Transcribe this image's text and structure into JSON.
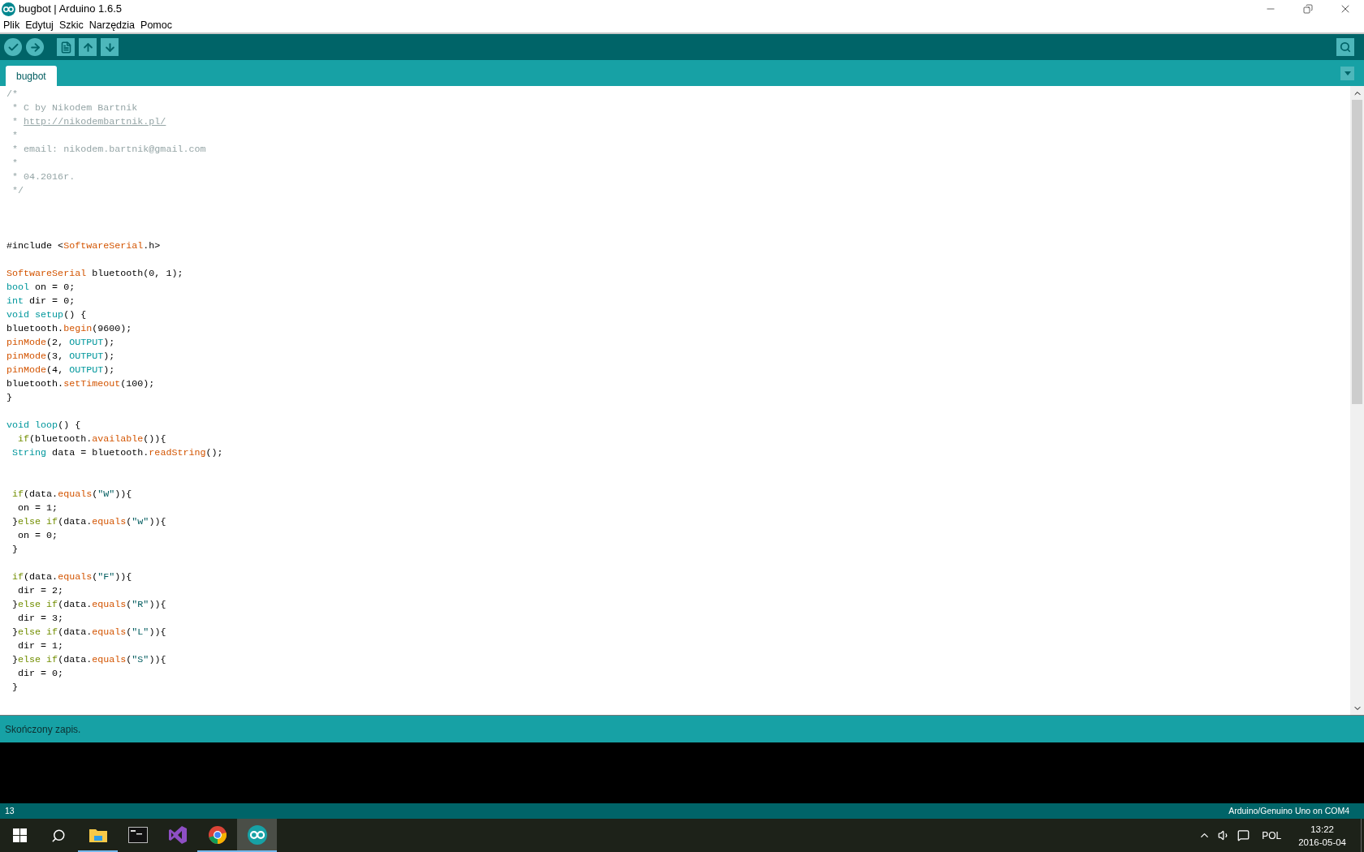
{
  "window": {
    "title": "bugbot | Arduino 1.6.5"
  },
  "menu": [
    {
      "label": "Plik"
    },
    {
      "label": "Edytuj"
    },
    {
      "label": "Szkic"
    },
    {
      "label": "Narzędzia"
    },
    {
      "label": "Pomoc"
    }
  ],
  "tabs": [
    {
      "label": "bugbot",
      "selected": true
    }
  ],
  "editor": {
    "lines": [
      {
        "tokens": [
          {
            "text": "/*",
            "kind": "comment"
          }
        ]
      },
      {
        "tokens": [
          {
            "text": " * C by Nikodem Bartnik",
            "kind": "comment"
          }
        ]
      },
      {
        "tokens": [
          {
            "text": " * ",
            "kind": "comment"
          },
          {
            "text": "http://nikodembartnik.pl/",
            "kind": "link"
          }
        ]
      },
      {
        "tokens": [
          {
            "text": " *",
            "kind": "comment"
          }
        ]
      },
      {
        "tokens": [
          {
            "text": " * email: nikodem.bartnik@gmail.com",
            "kind": "comment"
          }
        ]
      },
      {
        "tokens": [
          {
            "text": " *",
            "kind": "comment"
          }
        ]
      },
      {
        "tokens": [
          {
            "text": " * 04.2016r.",
            "kind": "comment"
          }
        ]
      },
      {
        "tokens": [
          {
            "text": " */",
            "kind": "comment"
          }
        ]
      },
      {
        "kind": "blank"
      },
      {
        "kind": "blank"
      },
      {
        "kind": "blank"
      },
      {
        "tokens": [
          {
            "text": "#include <",
            "kind": "plain"
          },
          {
            "text": "SoftwareSerial",
            "kind": "function"
          },
          {
            "text": ".h>",
            "kind": "plain"
          }
        ]
      },
      {
        "kind": "blank"
      },
      {
        "tokens": [
          {
            "text": "SoftwareSerial",
            "kind": "function"
          },
          {
            "text": " bluetooth(0, 1);",
            "kind": "plain"
          }
        ]
      },
      {
        "tokens": [
          {
            "text": "bool",
            "kind": "type"
          },
          {
            "text": " on = 0;",
            "kind": "plain"
          }
        ]
      },
      {
        "tokens": [
          {
            "text": "int",
            "kind": "type"
          },
          {
            "text": " dir = 0;",
            "kind": "plain"
          }
        ]
      },
      {
        "tokens": [
          {
            "text": "void setup",
            "kind": "type"
          },
          {
            "text": "() {",
            "kind": "plain"
          }
        ]
      },
      {
        "tokens": [
          {
            "text": "bluetooth.",
            "kind": "plain"
          },
          {
            "text": "begin",
            "kind": "function"
          },
          {
            "text": "(9600);",
            "kind": "plain"
          }
        ]
      },
      {
        "tokens": [
          {
            "text": "pinMode",
            "kind": "function"
          },
          {
            "text": "(2, ",
            "kind": "plain"
          },
          {
            "text": "OUTPUT",
            "kind": "constant"
          },
          {
            "text": ");",
            "kind": "plain"
          }
        ]
      },
      {
        "tokens": [
          {
            "text": "pinMode",
            "kind": "function"
          },
          {
            "text": "(3, ",
            "kind": "plain"
          },
          {
            "text": "OUTPUT",
            "kind": "constant"
          },
          {
            "text": ");",
            "kind": "plain"
          }
        ]
      },
      {
        "tokens": [
          {
            "text": "pinMode",
            "kind": "function"
          },
          {
            "text": "(4, ",
            "kind": "plain"
          },
          {
            "text": "OUTPUT",
            "kind": "constant"
          },
          {
            "text": ");",
            "kind": "plain"
          }
        ]
      },
      {
        "tokens": [
          {
            "text": "bluetooth.",
            "kind": "plain"
          },
          {
            "text": "setTimeout",
            "kind": "function"
          },
          {
            "text": "(100);",
            "kind": "plain"
          }
        ]
      },
      {
        "tokens": [
          {
            "text": "}",
            "kind": "plain"
          }
        ]
      },
      {
        "kind": "blank"
      },
      {
        "tokens": [
          {
            "text": "void loop",
            "kind": "type"
          },
          {
            "text": "() {",
            "kind": "plain"
          }
        ]
      },
      {
        "tokens": [
          {
            "text": "  if",
            "kind": "control"
          },
          {
            "text": "(bluetooth.",
            "kind": "plain"
          },
          {
            "text": "available",
            "kind": "function"
          },
          {
            "text": "()){",
            "kind": "plain"
          }
        ]
      },
      {
        "tokens": [
          {
            "text": " String",
            "kind": "type"
          },
          {
            "text": " data = bluetooth.",
            "kind": "plain"
          },
          {
            "text": "readString",
            "kind": "function"
          },
          {
            "text": "();",
            "kind": "plain"
          }
        ]
      },
      {
        "kind": "blank"
      },
      {
        "kind": "blank"
      },
      {
        "tokens": [
          {
            "text": " if",
            "kind": "control"
          },
          {
            "text": "(data.",
            "kind": "plain"
          },
          {
            "text": "equals",
            "kind": "function"
          },
          {
            "text": "(",
            "kind": "plain"
          },
          {
            "text": "\"W\"",
            "kind": "string"
          },
          {
            "text": ")){",
            "kind": "plain"
          }
        ]
      },
      {
        "tokens": [
          {
            "text": "  on = 1;",
            "kind": "plain"
          }
        ]
      },
      {
        "tokens": [
          {
            "text": " }",
            "kind": "plain"
          },
          {
            "text": "else if",
            "kind": "control"
          },
          {
            "text": "(data.",
            "kind": "plain"
          },
          {
            "text": "equals",
            "kind": "function"
          },
          {
            "text": "(",
            "kind": "plain"
          },
          {
            "text": "\"w\"",
            "kind": "string"
          },
          {
            "text": ")){",
            "kind": "plain"
          }
        ]
      },
      {
        "tokens": [
          {
            "text": "  on = 0;",
            "kind": "plain"
          }
        ]
      },
      {
        "tokens": [
          {
            "text": " }",
            "kind": "plain"
          }
        ]
      },
      {
        "kind": "blank"
      },
      {
        "tokens": [
          {
            "text": " if",
            "kind": "control"
          },
          {
            "text": "(data.",
            "kind": "plain"
          },
          {
            "text": "equals",
            "kind": "function"
          },
          {
            "text": "(",
            "kind": "plain"
          },
          {
            "text": "\"F\"",
            "kind": "string"
          },
          {
            "text": ")){",
            "kind": "plain"
          }
        ]
      },
      {
        "tokens": [
          {
            "text": "  dir = 2;",
            "kind": "plain"
          }
        ]
      },
      {
        "tokens": [
          {
            "text": " }",
            "kind": "plain"
          },
          {
            "text": "else if",
            "kind": "control"
          },
          {
            "text": "(data.",
            "kind": "plain"
          },
          {
            "text": "equals",
            "kind": "function"
          },
          {
            "text": "(",
            "kind": "plain"
          },
          {
            "text": "\"R\"",
            "kind": "string"
          },
          {
            "text": ")){",
            "kind": "plain"
          }
        ]
      },
      {
        "tokens": [
          {
            "text": "  dir = 3;",
            "kind": "plain"
          }
        ]
      },
      {
        "tokens": [
          {
            "text": " }",
            "kind": "plain"
          },
          {
            "text": "else if",
            "kind": "control"
          },
          {
            "text": "(data.",
            "kind": "plain"
          },
          {
            "text": "equals",
            "kind": "function"
          },
          {
            "text": "(",
            "kind": "plain"
          },
          {
            "text": "\"L\"",
            "kind": "string"
          },
          {
            "text": ")){",
            "kind": "plain"
          }
        ]
      },
      {
        "tokens": [
          {
            "text": "  dir = 1;",
            "kind": "plain"
          }
        ]
      },
      {
        "tokens": [
          {
            "text": " }",
            "kind": "plain"
          },
          {
            "text": "else if",
            "kind": "control"
          },
          {
            "text": "(data.",
            "kind": "plain"
          },
          {
            "text": "equals",
            "kind": "function"
          },
          {
            "text": "(",
            "kind": "plain"
          },
          {
            "text": "\"S\"",
            "kind": "string"
          },
          {
            "text": ")){",
            "kind": "plain"
          }
        ]
      },
      {
        "tokens": [
          {
            "text": "  dir = 0;",
            "kind": "plain"
          }
        ]
      },
      {
        "tokens": [
          {
            "text": " }",
            "kind": "plain"
          }
        ]
      }
    ]
  },
  "status": {
    "message": "Skończony zapis."
  },
  "footer": {
    "line_number": "13",
    "board": "Arduino/Genuino Uno on COM4"
  },
  "taskbar": {
    "buttons": [
      {
        "kind": "start"
      },
      {
        "kind": "search"
      }
    ],
    "apps": [
      {
        "kind": "explorer",
        "running": true,
        "selected": false
      },
      {
        "kind": "terminal",
        "running": false,
        "selected": false
      },
      {
        "kind": "studio",
        "running": false,
        "selected": false
      },
      {
        "kind": "browser",
        "running": true,
        "selected": false
      },
      {
        "kind": "arduino",
        "running": true,
        "selected": true
      }
    ],
    "tray": {
      "language": "POL",
      "time": "13:22",
      "date": "2016-05-04"
    }
  }
}
